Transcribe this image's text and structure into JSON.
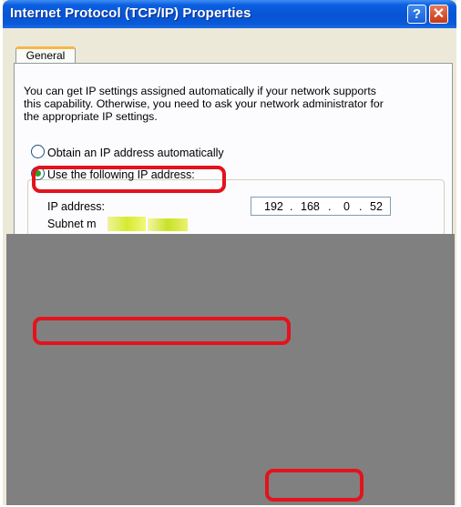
{
  "window": {
    "title": "Internet Protocol (TCP/IP) Properties",
    "help_glyph": "?",
    "close_glyph": "✕"
  },
  "tabs": [
    {
      "label": "General"
    }
  ],
  "description": {
    "line1": "You can get IP settings assigned automatically if your network supports",
    "line2": "this capability. Otherwise, you need to ask your network administrator for",
    "line3": "the appropriate IP settings."
  },
  "options": {
    "auto": {
      "label": "Obtain an IP address automatically",
      "selected": false
    },
    "manual": {
      "label": "Use the following IP address:",
      "selected": true
    }
  },
  "ip_section": {
    "ip_label": "IP address:",
    "ip_octets": [
      "192",
      "168",
      "0",
      "52"
    ],
    "dot": ".",
    "subnet_label": "Subnet m"
  },
  "colors": {
    "titlebar": "#0753d4",
    "dialog_bg": "#ece9d8",
    "highlight": "#e3131d",
    "redaction": "#808080"
  }
}
